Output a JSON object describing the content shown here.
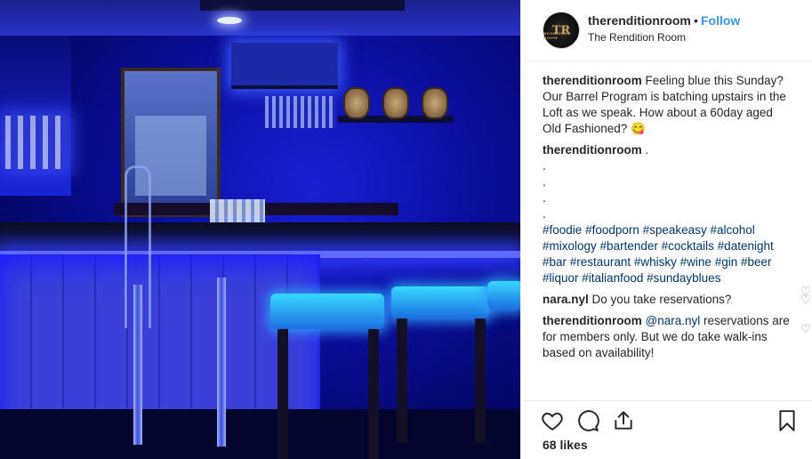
{
  "post": {
    "username": "therenditionroom",
    "separator": "•",
    "follow_label": "Follow",
    "location": "The Rendition Room",
    "avatar_text": "TR",
    "avatar_subtext": "RENDITION ROOM"
  },
  "caption": {
    "username": "therenditionroom",
    "text": "Feeling blue this Sunday? Our Barrel Program is batching upstairs in the Loft as we speak. How about a 60day aged Old Fashioned? 😋"
  },
  "hashtag_comment": {
    "username": "therenditionroom",
    "text": " .",
    "dots": [
      ".",
      ".",
      ".",
      "."
    ],
    "hashtags": [
      "#foodie",
      "#foodporn",
      "#speakeasy",
      "#alcohol",
      "#mixology",
      "#bartender",
      "#cocktails",
      "#datenight",
      "#bar",
      "#restaurant",
      "#whisky",
      "#wine",
      "#gin",
      "#beer",
      "#liquor",
      "#italianfood",
      "#sundayblues"
    ]
  },
  "comment_1": {
    "username": "nara.nyl",
    "text": "Do you take reservations?"
  },
  "comment_2": {
    "username": "therenditionroom",
    "mention": "@nara.nyl",
    "text": "reservations are for members only. But we do take walk-ins based on availability!"
  },
  "actions": {
    "icons": [
      "heart-icon",
      "comment-icon",
      "share-icon",
      "bookmark-icon"
    ]
  },
  "likes": "68 likes",
  "colors": {
    "link_blue": "#3897f0",
    "hashtag": "#003569",
    "text": "#262626",
    "muted": "#8e8e8e"
  }
}
